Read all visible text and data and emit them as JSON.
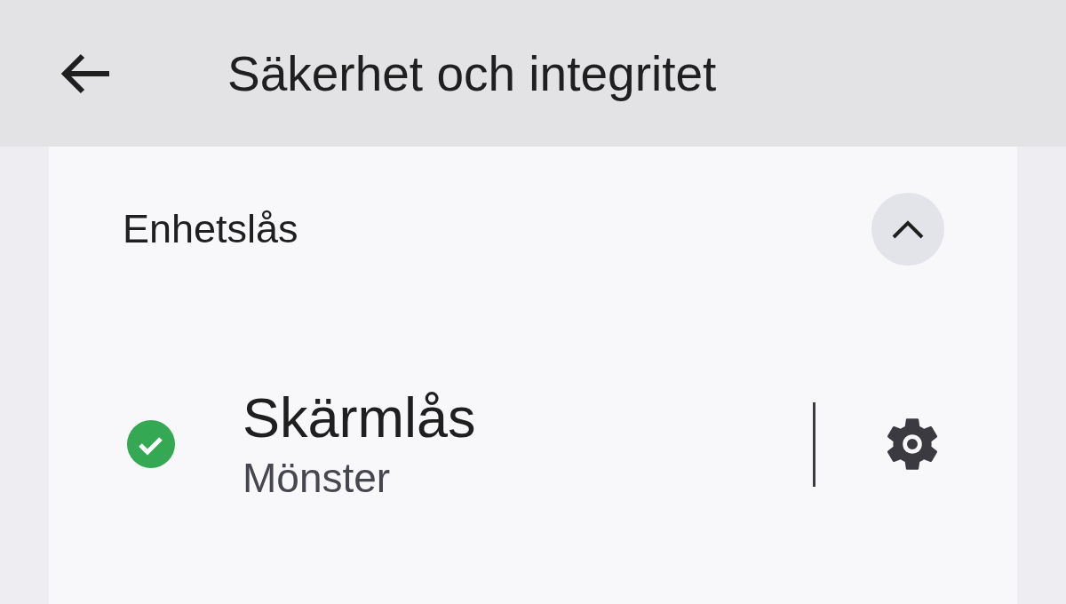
{
  "app_bar": {
    "title": "Säkerhet och integritet"
  },
  "section": {
    "title": "Enhetslås",
    "expanded": true,
    "items": [
      {
        "title": "Skärmlås",
        "subtitle": "Mönster",
        "enabled": true
      }
    ]
  }
}
